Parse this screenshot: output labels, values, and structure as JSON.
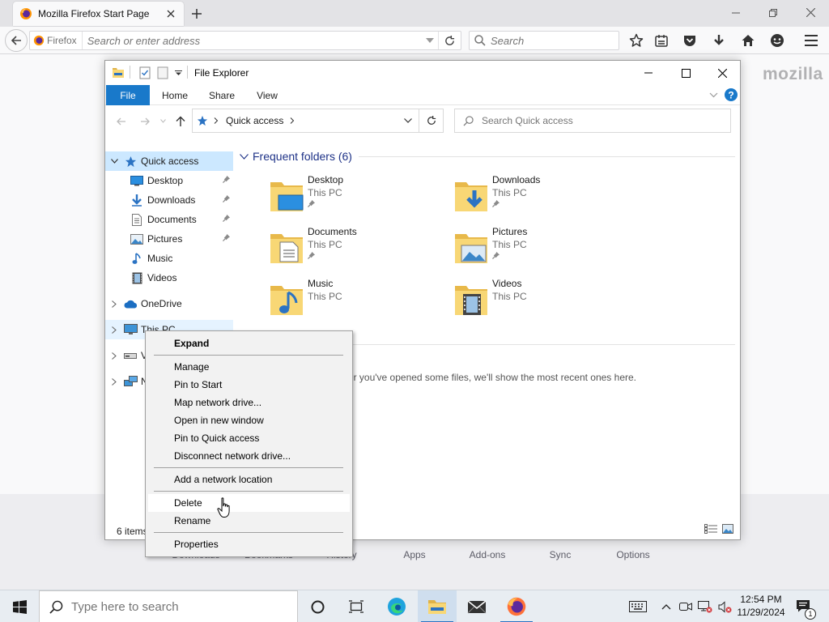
{
  "browser": {
    "tab_title": "Mozilla Firefox Start Page",
    "identity_label": "Firefox",
    "url_placeholder": "Search or enter address",
    "search_placeholder": "Search",
    "wordmark": "mozilla",
    "launcher": [
      "Downloads",
      "Bookmarks",
      "History",
      "Apps",
      "Add-ons",
      "Sync",
      "Options"
    ]
  },
  "explorer": {
    "title": "File Explorer",
    "ribbon_tabs": [
      "File",
      "Home",
      "Share",
      "View"
    ],
    "address_segment": "Quick access",
    "search_placeholder": "Search Quick access",
    "nav": {
      "quick_access": "Quick access",
      "desktop": "Desktop",
      "downloads": "Downloads",
      "documents": "Documents",
      "pictures": "Pictures",
      "music": "Music",
      "videos": "Videos",
      "onedrive": "OneDrive",
      "this_pc": "This PC",
      "drive_partial": "V",
      "network_partial": "N"
    },
    "frequent_header": "Frequent folders (6)",
    "folders": [
      {
        "name": "Desktop",
        "location": "This PC",
        "pinned": true
      },
      {
        "name": "Downloads",
        "location": "This PC",
        "pinned": true
      },
      {
        "name": "Documents",
        "location": "This PC",
        "pinned": true
      },
      {
        "name": "Pictures",
        "location": "This PC",
        "pinned": true
      },
      {
        "name": "Music",
        "location": "This PC",
        "pinned": false
      },
      {
        "name": "Videos",
        "location": "This PC",
        "pinned": false
      }
    ],
    "recent_empty_text": "er you've opened some files, we'll show the most recent ones here.",
    "status": "6 items"
  },
  "context_menu": {
    "items": [
      "Expand",
      "Manage",
      "Pin to Start",
      "Map network drive...",
      "Open in new window",
      "Pin to Quick access",
      "Disconnect network drive...",
      "Add a network location",
      "Delete",
      "Rename",
      "Properties"
    ],
    "hovered": "Delete"
  },
  "taskbar": {
    "search_placeholder": "Type here to search",
    "time": "12:54 PM",
    "date": "11/29/2024",
    "notification_count": "1"
  },
  "colors": {
    "file_tab": "#1979ca",
    "quick_access_selected": "#cce8ff",
    "section_header": "#1e3287",
    "folder_yellow": "#f8d775"
  }
}
